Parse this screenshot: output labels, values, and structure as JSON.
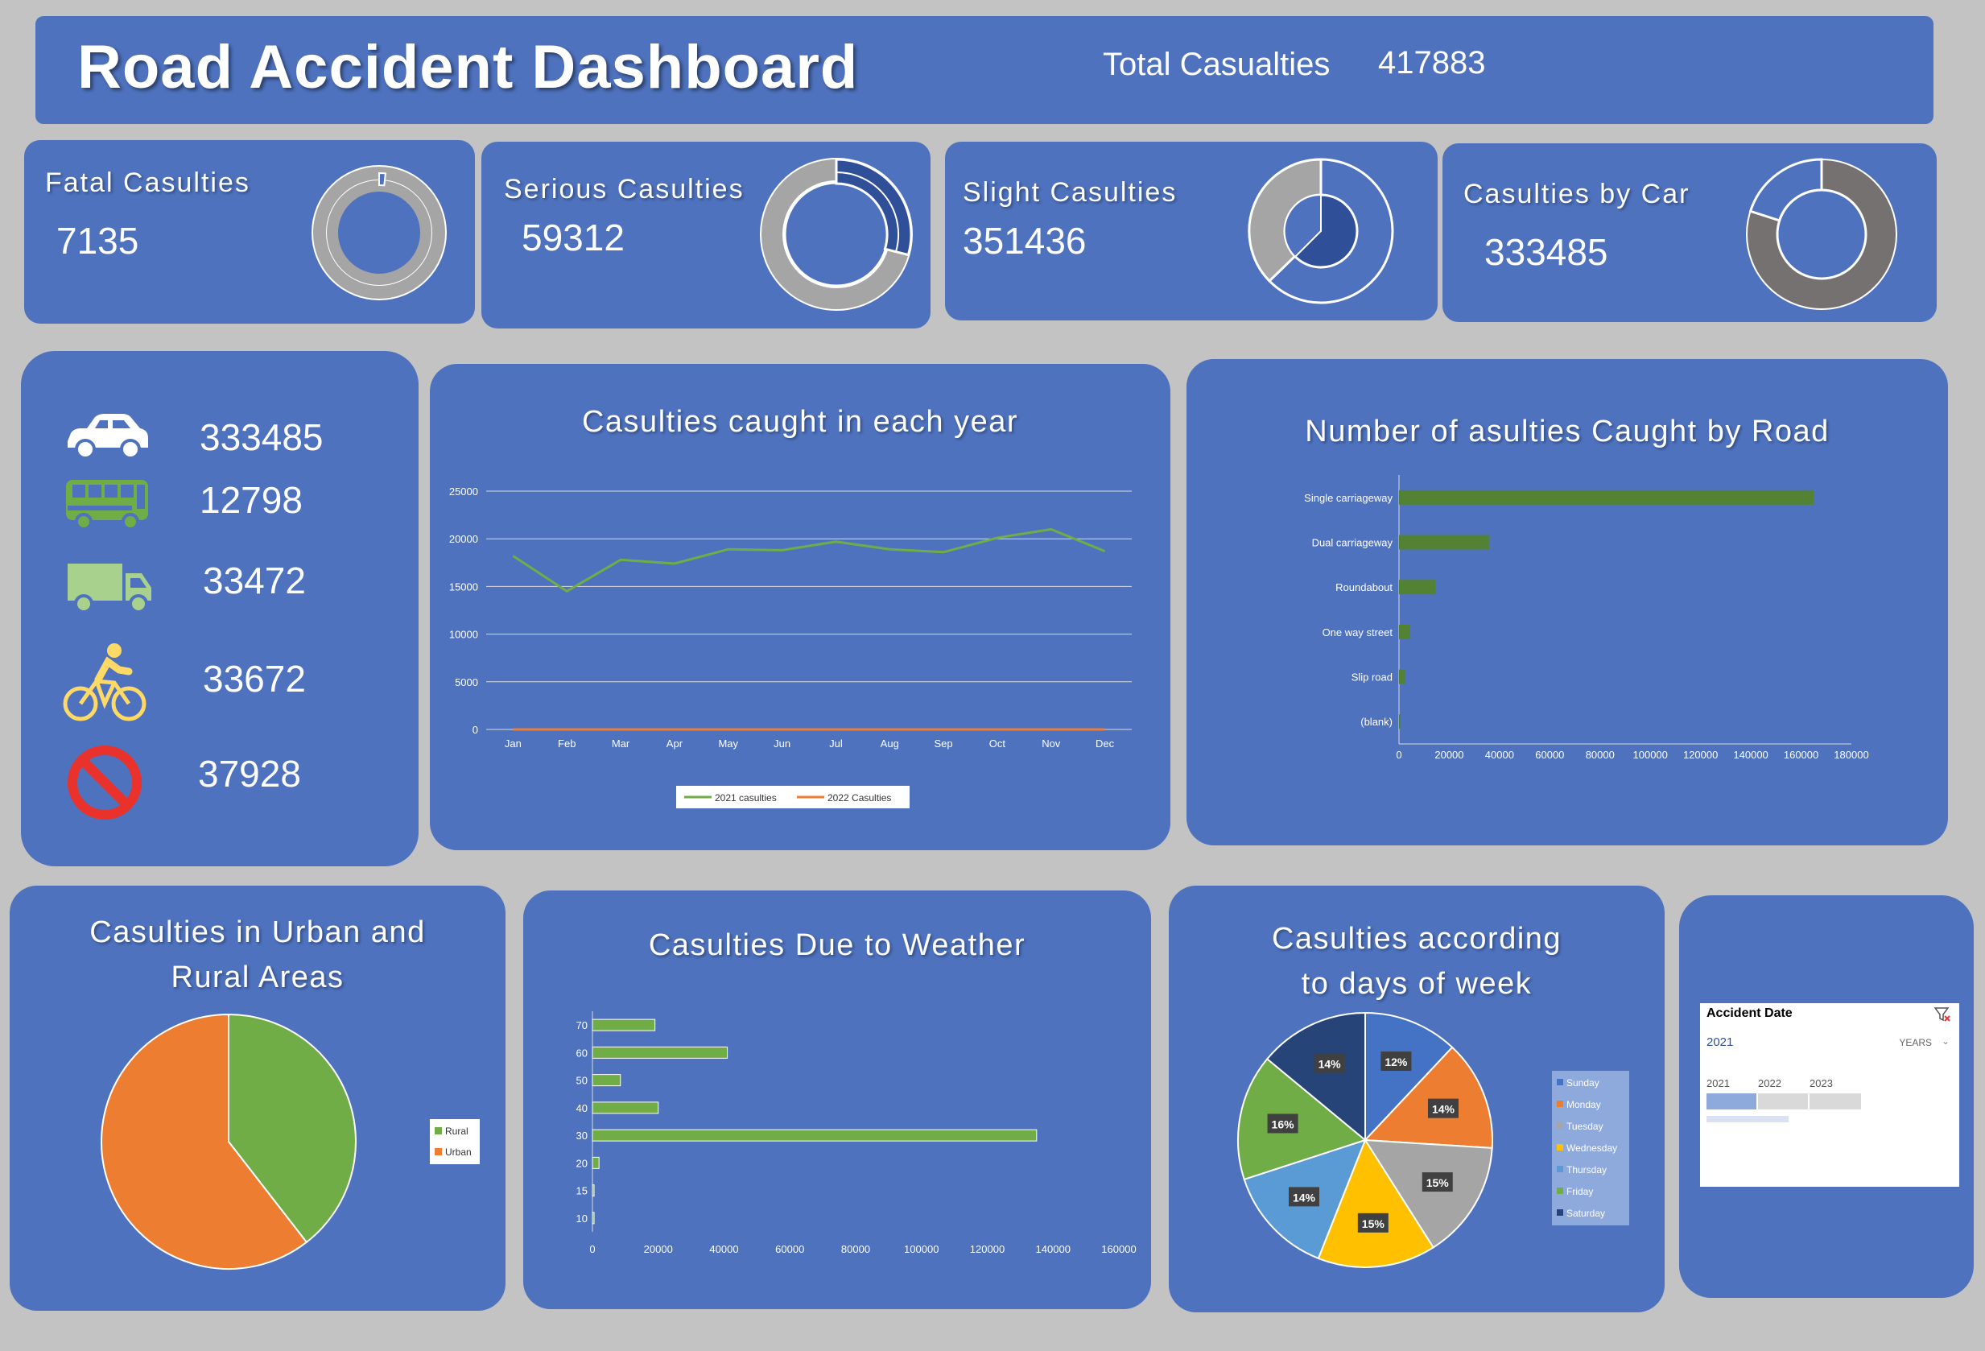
{
  "header": {
    "title": "Road Accident Dashboard",
    "total_label": "Total Casualties",
    "total_value": "417883"
  },
  "kpis": [
    {
      "label": "Fatal Casulties",
      "value": "7135",
      "share": 0.017
    },
    {
      "label": "Serious Casulties",
      "value": "59312",
      "share": 0.142
    },
    {
      "label": "Slight Casulties",
      "value": "351436",
      "share": 0.841
    },
    {
      "label": "Casulties  by  Car",
      "value": "333485",
      "share": 0.798
    }
  ],
  "vehicles": [
    {
      "icon": "car-icon",
      "value": "333485"
    },
    {
      "icon": "bus-icon",
      "value": "12798"
    },
    {
      "icon": "truck-icon",
      "value": "33472"
    },
    {
      "icon": "bicycle-icon",
      "value": "33672"
    },
    {
      "icon": "no-entry-icon",
      "value": "37928"
    }
  ],
  "colors": {
    "card": "#4e72be",
    "background": "#c3c3c3",
    "green": "#70ad47",
    "dark_green": "#548235",
    "orange": "#ed7d31",
    "gray": "#a5a5a5"
  },
  "chart_data": [
    {
      "type": "line",
      "title": "Casulties caught in each year",
      "categories": [
        "Jan",
        "Feb",
        "Mar",
        "Apr",
        "May",
        "Jun",
        "Jul",
        "Aug",
        "Sep",
        "Oct",
        "Nov",
        "Dec"
      ],
      "yticks": [
        "0",
        "5000",
        "10000",
        "15000",
        "20000",
        "25000"
      ],
      "ylim": [
        0,
        25000
      ],
      "series": [
        {
          "name": "2021 casulties",
          "color": "#70ad47",
          "values": [
            18200,
            14500,
            17800,
            17400,
            18900,
            18800,
            19700,
            18900,
            18600,
            20100,
            21000,
            18700
          ]
        },
        {
          "name": "2022 Casulties",
          "color": "#ed7d31",
          "values": [
            0,
            0,
            0,
            0,
            0,
            0,
            0,
            0,
            0,
            0,
            0,
            0
          ]
        }
      ]
    },
    {
      "type": "bar",
      "title": "Number of asulties Caught by Road",
      "categories": [
        "Single carriageway",
        "Dual carriageway",
        "Roundabout",
        "One way street",
        "Slip road",
        "(blank)"
      ],
      "values": [
        165000,
        36000,
        14500,
        4500,
        2500,
        600
      ],
      "xticks": [
        "0",
        "20000",
        "40000",
        "60000",
        "80000",
        "100000",
        "120000",
        "140000",
        "160000",
        "180000"
      ],
      "xlim": [
        0,
        180000
      ]
    },
    {
      "type": "pie",
      "title": "Casulties in Urban and Rural Areas",
      "labels": [
        "Rural",
        "Urban"
      ],
      "values": [
        39.5,
        60.5
      ],
      "colors": [
        "#70ad47",
        "#ed7d31"
      ]
    },
    {
      "type": "bar",
      "title": "Casulties Due to Weather",
      "categories": [
        "70",
        "60",
        "50",
        "40",
        "30",
        "20",
        "15",
        "10"
      ],
      "values": [
        19000,
        41000,
        8500,
        20000,
        135000,
        2000,
        500,
        500
      ],
      "xticks": [
        "0",
        "20000",
        "40000",
        "60000",
        "80000",
        "100000",
        "120000",
        "140000",
        "160000"
      ],
      "xlim": [
        0,
        160000
      ]
    },
    {
      "type": "pie",
      "title": "Casulties according to days of week",
      "labels": [
        "Sunday",
        "Monday",
        "Tuesday",
        "Wednesday",
        "Thursday",
        "Friday",
        "Saturday"
      ],
      "values": [
        12,
        14,
        15,
        15,
        14,
        16,
        14
      ],
      "data_labels": [
        "12%",
        "14%",
        "15%",
        "15%",
        "14%",
        "16%",
        "14%"
      ],
      "colors": [
        "#4472c4",
        "#ed7d31",
        "#a5a5a5",
        "#ffc000",
        "#5b9bd5",
        "#70ad47",
        "#264478"
      ]
    }
  ],
  "slicer": {
    "title": "Accident Date",
    "selected": "2021",
    "level": "YEARS",
    "years": [
      "2021",
      "2022",
      "2023"
    ]
  }
}
